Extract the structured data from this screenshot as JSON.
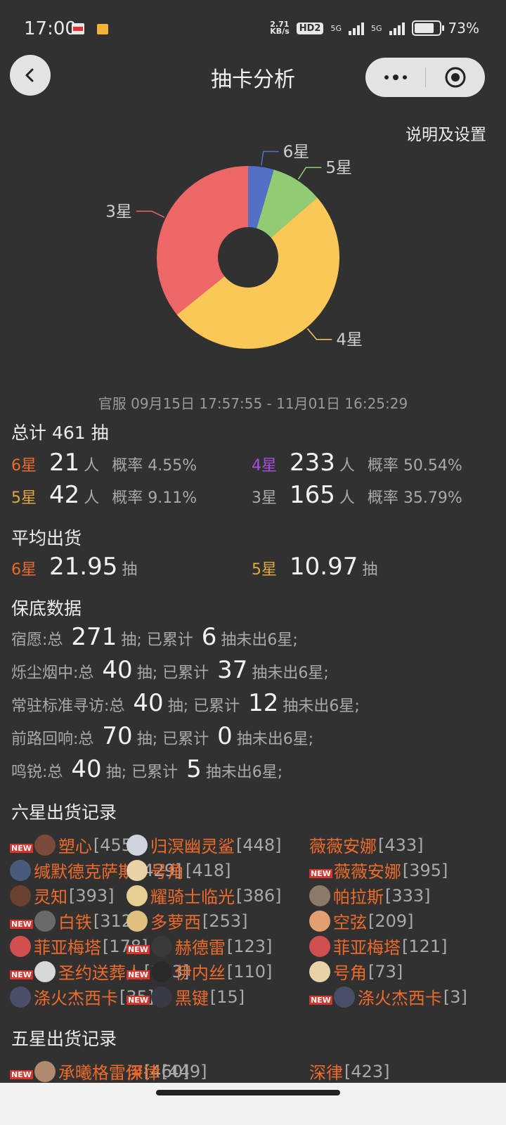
{
  "status_bar": {
    "time": "17:00",
    "network_speed": "2.71",
    "network_unit": "KB/s",
    "hd": "HD2",
    "signal1": "5G",
    "signal2": "5G",
    "battery": "73%"
  },
  "header": {
    "title": "抽卡分析",
    "settings_link": "说明及设置"
  },
  "chart_data": {
    "type": "pie",
    "categories": [
      "6星",
      "5星",
      "4星",
      "3星"
    ],
    "values": [
      21,
      42,
      233,
      165
    ],
    "colors": [
      "#5470c6",
      "#91cc75",
      "#fac858",
      "#ee6666"
    ],
    "donut": true
  },
  "time_range": "官服  09月15日 17:57:55  -  11月01日 16:25:29",
  "total": {
    "label": "总计 461 抽"
  },
  "stars": [
    {
      "star": "6星",
      "count": "21",
      "unit": "人",
      "rate_label": "概率",
      "rate": "4.55%"
    },
    {
      "star": "4星",
      "count": "233",
      "unit": "人",
      "rate_label": "概率",
      "rate": "50.54%"
    },
    {
      "star": "5星",
      "count": "42",
      "unit": "人",
      "rate_label": "概率",
      "rate": "9.11%"
    },
    {
      "star": "3星",
      "count": "165",
      "unit": "人",
      "rate_label": "概率",
      "rate": "35.79%"
    }
  ],
  "average": {
    "heading": "平均出货",
    "six": {
      "star": "6星",
      "value": "21.95",
      "unit": "抽"
    },
    "five": {
      "star": "5星",
      "value": "10.97",
      "unit": "抽"
    }
  },
  "guarantee": {
    "heading": "保底数据",
    "rows": [
      {
        "pool": "宿愿:总",
        "total": "271",
        "mid": "抽;  已累计",
        "acc": "6",
        "tail": "抽未出6星;"
      },
      {
        "pool": "烁尘烟中:总",
        "total": "40",
        "mid": "抽;  已累计",
        "acc": "37",
        "tail": "抽未出6星;"
      },
      {
        "pool": "常驻标准寻访:总",
        "total": "40",
        "mid": "抽;  已累计",
        "acc": "12",
        "tail": "抽未出6星;"
      },
      {
        "pool": "前路回响:总",
        "total": "70",
        "mid": "抽;  已累计",
        "acc": "0",
        "tail": "抽未出6星;"
      },
      {
        "pool": "鸣锐:总",
        "total": "40",
        "mid": "抽;  已累计",
        "acc": "5",
        "tail": "抽未出6星;"
      }
    ]
  },
  "six_records": {
    "heading": "六星出货记录",
    "new_label": "NEW",
    "items": [
      {
        "name": "塑心",
        "pull": "[455]",
        "new": true,
        "av": "#7a4a3a"
      },
      {
        "name": "归溟幽灵鲨",
        "pull": "[448]",
        "new": false,
        "av": "#cfd4dc"
      },
      {
        "name": "薇薇安娜",
        "pull": "[433]",
        "new": false,
        "av": ""
      },
      {
        "name": "缄默德克萨斯",
        "pull": "[429]",
        "new": false,
        "av": "#4a5a7a"
      },
      {
        "name": "号角",
        "pull": "[418]",
        "new": false,
        "av": "#e8d2a8"
      },
      {
        "name": "薇薇安娜",
        "pull": "[395]",
        "new": true,
        "av": ""
      },
      {
        "name": "灵知",
        "pull": "[393]",
        "new": false,
        "av": "#6a4030"
      },
      {
        "name": "耀骑士临光",
        "pull": "[386]",
        "new": false,
        "av": "#e6cf90"
      },
      {
        "name": "帕拉斯",
        "pull": "[333]",
        "new": false,
        "av": "#8a7a6a"
      },
      {
        "name": "白铁",
        "pull": "[312]",
        "new": true,
        "av": "#6a6a6a"
      },
      {
        "name": "多萝西",
        "pull": "[253]",
        "new": false,
        "av": "#e0c080"
      },
      {
        "name": "空弦",
        "pull": "[209]",
        "new": false,
        "av": "#e2a070"
      },
      {
        "name": "菲亚梅塔",
        "pull": "[178]",
        "new": false,
        "av": "#d05050"
      },
      {
        "name": "赫德雷",
        "pull": "[123]",
        "new": true,
        "av": "#3a3a3a"
      },
      {
        "name": "菲亚梅塔",
        "pull": "[121]",
        "new": false,
        "av": "#d05050"
      },
      {
        "name": "圣约送葬人",
        "pull": "[113]",
        "new": true,
        "av": "#d8d8d8"
      },
      {
        "name": "伊内丝",
        "pull": "[110]",
        "new": true,
        "av": "#2a2a2a"
      },
      {
        "name": "号角",
        "pull": "[73]",
        "new": false,
        "av": "#e8d2a8"
      },
      {
        "name": "涤火杰西卡",
        "pull": "[35]",
        "new": false,
        "av": "#4a4e68"
      },
      {
        "name": "黑键",
        "pull": "[15]",
        "new": true,
        "av": "#3a3a44"
      },
      {
        "name": "涤火杰西卡",
        "pull": "[3]",
        "new": true,
        "av": "#4a4e68"
      }
    ]
  },
  "five_records": {
    "heading": "五星出货记录",
    "items": [
      {
        "name": "承曦格雷伊",
        "pull": "[460]",
        "new": true,
        "av": "#b08a70"
      },
      {
        "name": "深律",
        "pull": "[449]",
        "new": false,
        "av": ""
      },
      {
        "name": "深律",
        "pull": "[423]",
        "new": false,
        "av": ""
      }
    ]
  }
}
